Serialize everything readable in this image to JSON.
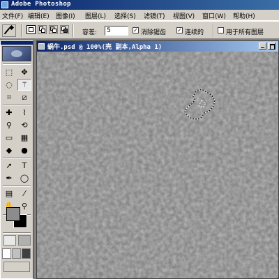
{
  "app": {
    "title": "Adobe Photoshop"
  },
  "menu": {
    "items": [
      "文件(F)",
      "编辑(E)",
      "图像(I)",
      "图层(L)",
      "选择(S)",
      "滤镜(T)",
      "视图(V)",
      "窗口(W)",
      "帮助(H)"
    ]
  },
  "options": {
    "tolerance_label": "容差:",
    "tolerance_value": "5",
    "antialias": {
      "label": "消除锯齿",
      "checked": true,
      "mark": "✓"
    },
    "contiguous": {
      "label": "连续的",
      "checked": true,
      "mark": "✓"
    },
    "all_layers": {
      "label": "用于所有图层",
      "checked": false,
      "mark": ""
    }
  },
  "toolbox": {
    "tools": [
      {
        "name": "marquee",
        "icon": "⬚"
      },
      {
        "name": "move",
        "icon": "✥"
      },
      {
        "name": "lasso",
        "icon": "◌"
      },
      {
        "name": "magic-wand",
        "icon": "⚚",
        "active": true
      },
      {
        "name": "crop",
        "icon": "⌗"
      },
      {
        "name": "slice",
        "icon": "⧄"
      },
      {
        "name": "healing",
        "icon": "✚"
      },
      {
        "name": "brush",
        "icon": "⌇"
      },
      {
        "name": "clone-stamp",
        "icon": "⚲"
      },
      {
        "name": "history-brush",
        "icon": "⟲"
      },
      {
        "name": "eraser",
        "icon": "▭"
      },
      {
        "name": "gradient",
        "icon": "▦"
      },
      {
        "name": "blur",
        "icon": "◆"
      },
      {
        "name": "dodge",
        "icon": "●"
      },
      {
        "name": "path-select",
        "icon": "➚"
      },
      {
        "name": "type",
        "icon": "T"
      },
      {
        "name": "pen",
        "icon": "✒"
      },
      {
        "name": "shape",
        "icon": "◯"
      },
      {
        "name": "notes",
        "icon": "▤"
      },
      {
        "name": "eyedropper",
        "icon": "⁄"
      },
      {
        "name": "hand",
        "icon": "✋"
      },
      {
        "name": "zoom",
        "icon": "⚲"
      }
    ]
  },
  "document": {
    "title": "蜗牛.psd @ 100%(壳 副本,Alpha 1)"
  },
  "colors": {
    "canvas_base": "#7a7a7a",
    "foreground": "#8c8c8c",
    "background": "#000000",
    "title_active": "#0a246a"
  }
}
